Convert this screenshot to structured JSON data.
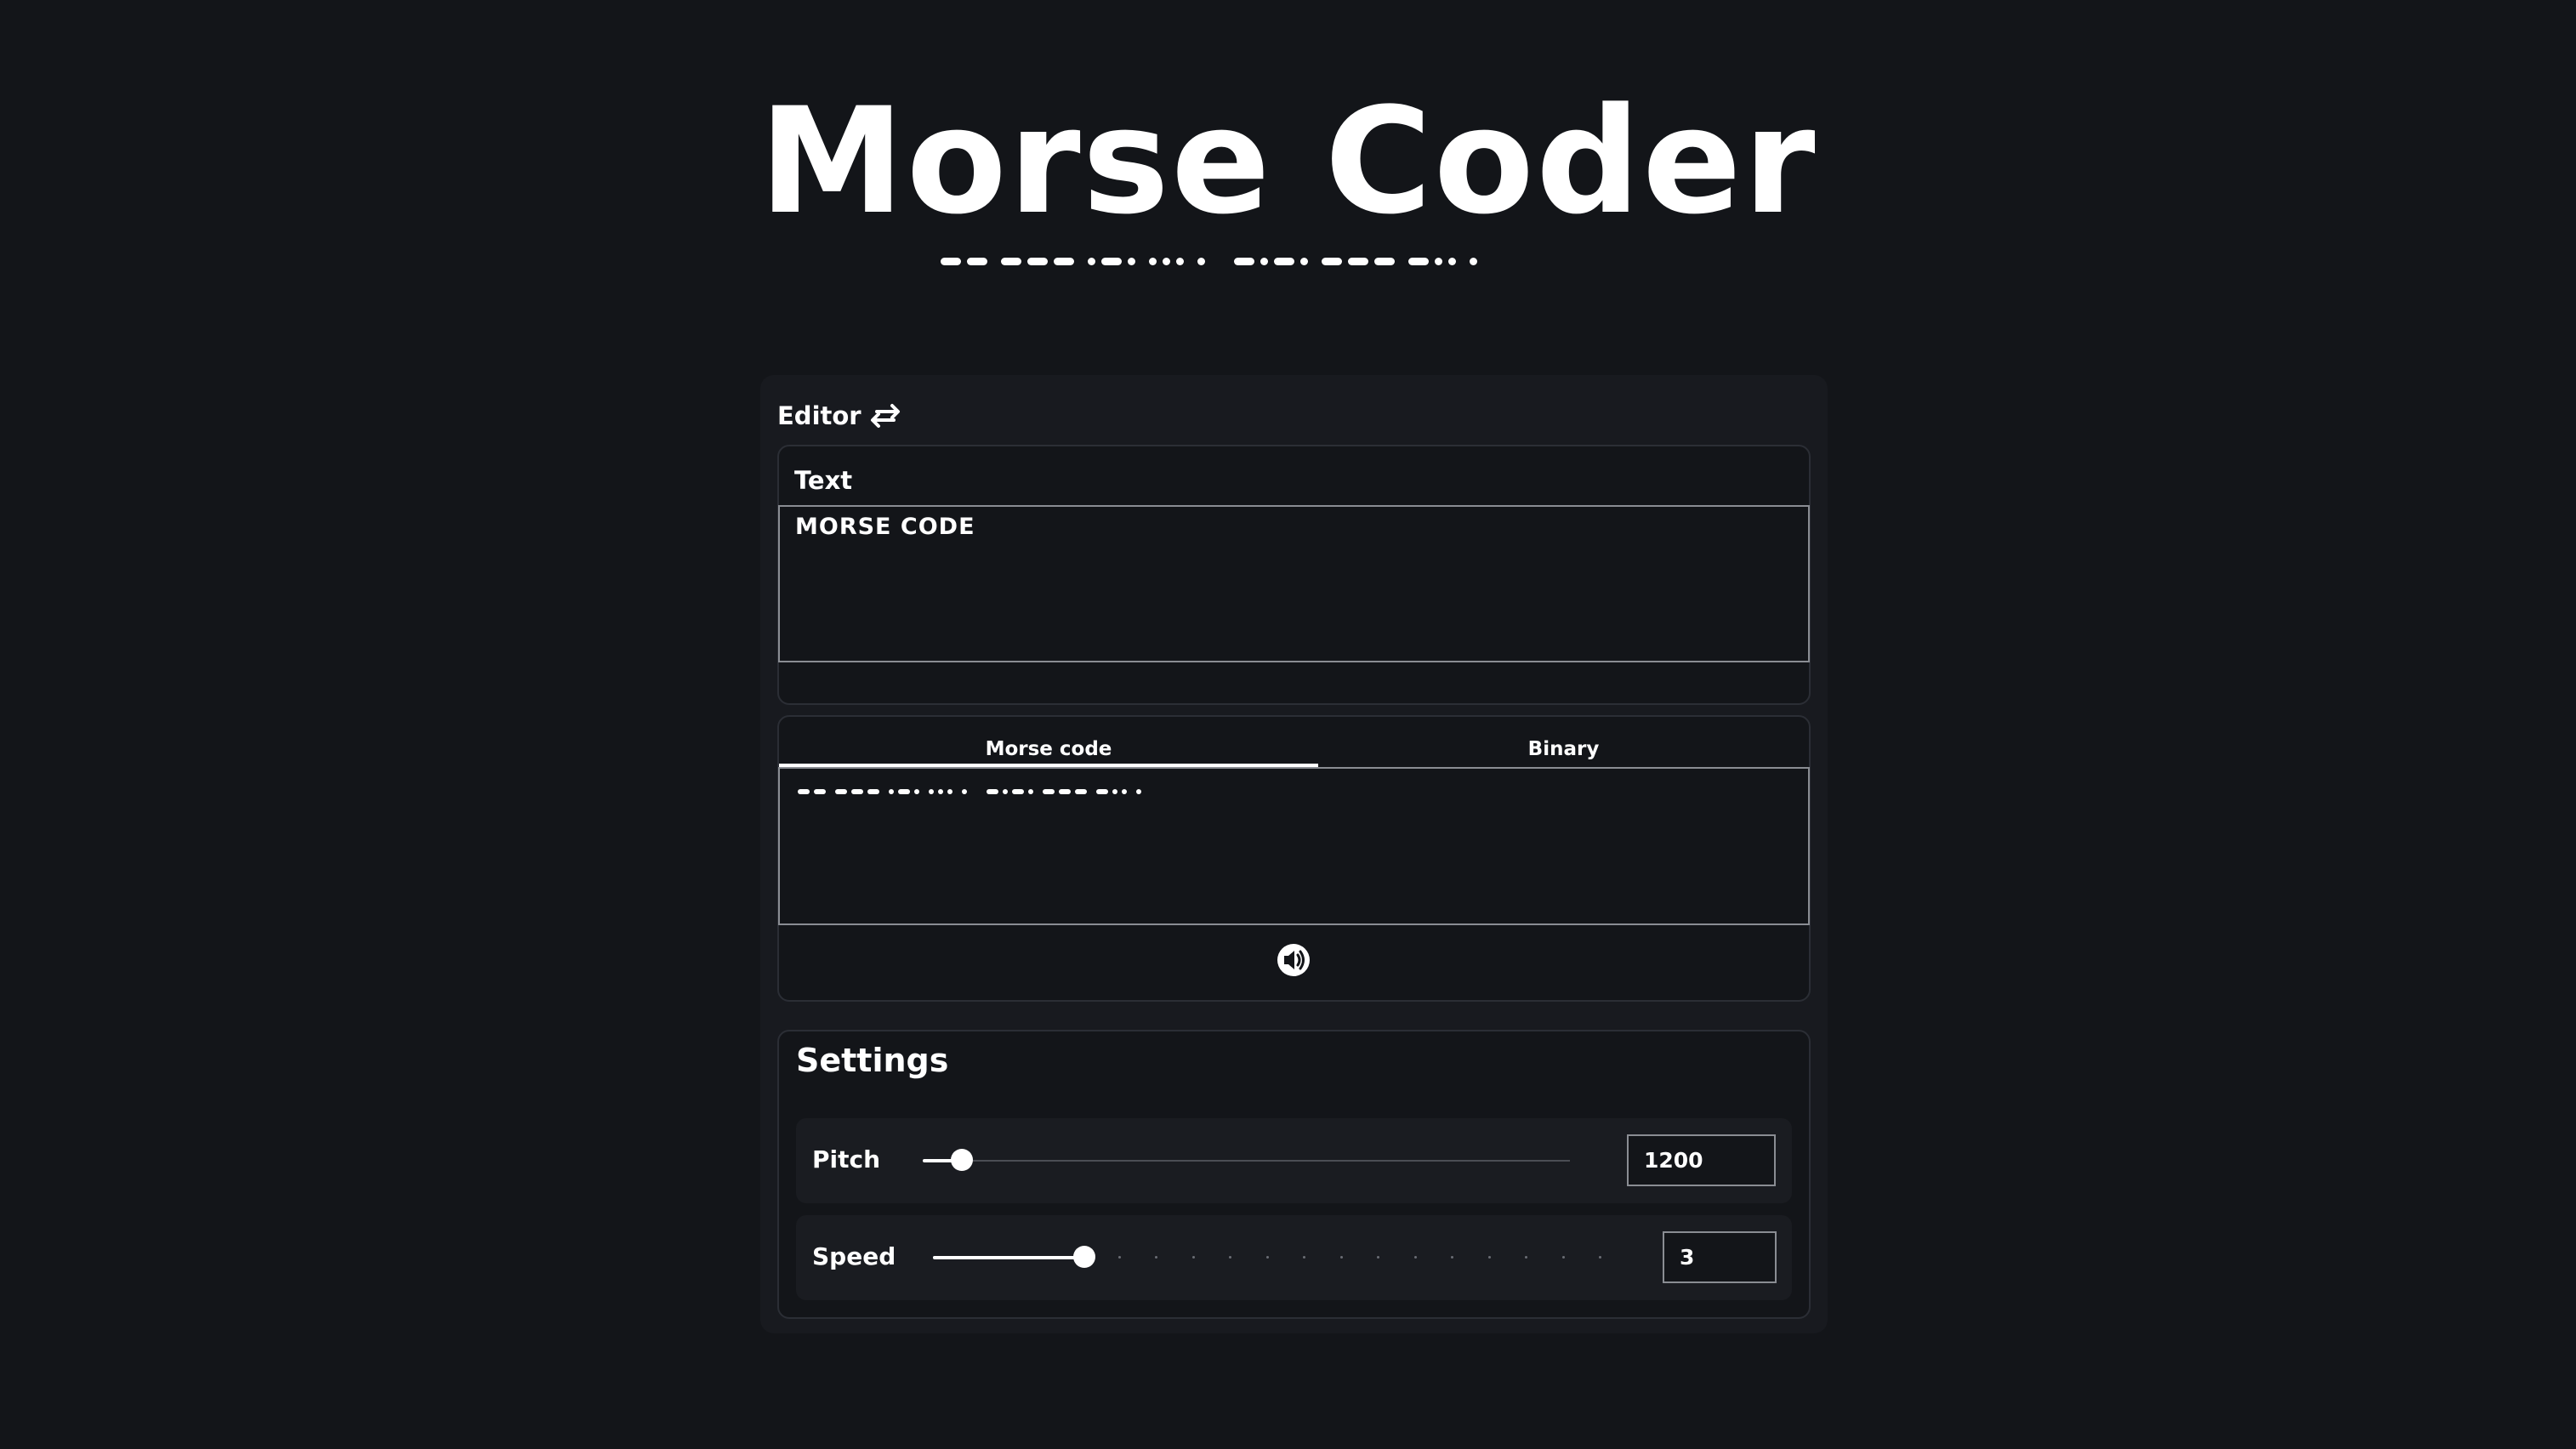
{
  "app": {
    "title": "Morse Coder",
    "title_morse": "-- --- .-. ... .   -.-. --- -.. ."
  },
  "editor": {
    "heading": "Editor",
    "swap_icon": "swap-arrows-icon",
    "text_label": "Text",
    "text_value": "MORSE CODE",
    "output_tabs": [
      {
        "label": "Morse code",
        "active": true
      },
      {
        "label": "Binary",
        "active": false
      }
    ],
    "output_value": "-- --- .-. ... .   -.-. --- -.. .",
    "play_icon": "speaker-icon"
  },
  "settings": {
    "title": "Settings",
    "pitch": {
      "label": "Pitch",
      "value": "1200"
    },
    "speed": {
      "label": "Speed",
      "value": "3"
    }
  },
  "colors": {
    "background": "#131519",
    "card": "#181a1f",
    "text": "#ffffff",
    "border": "#2b2e35"
  }
}
